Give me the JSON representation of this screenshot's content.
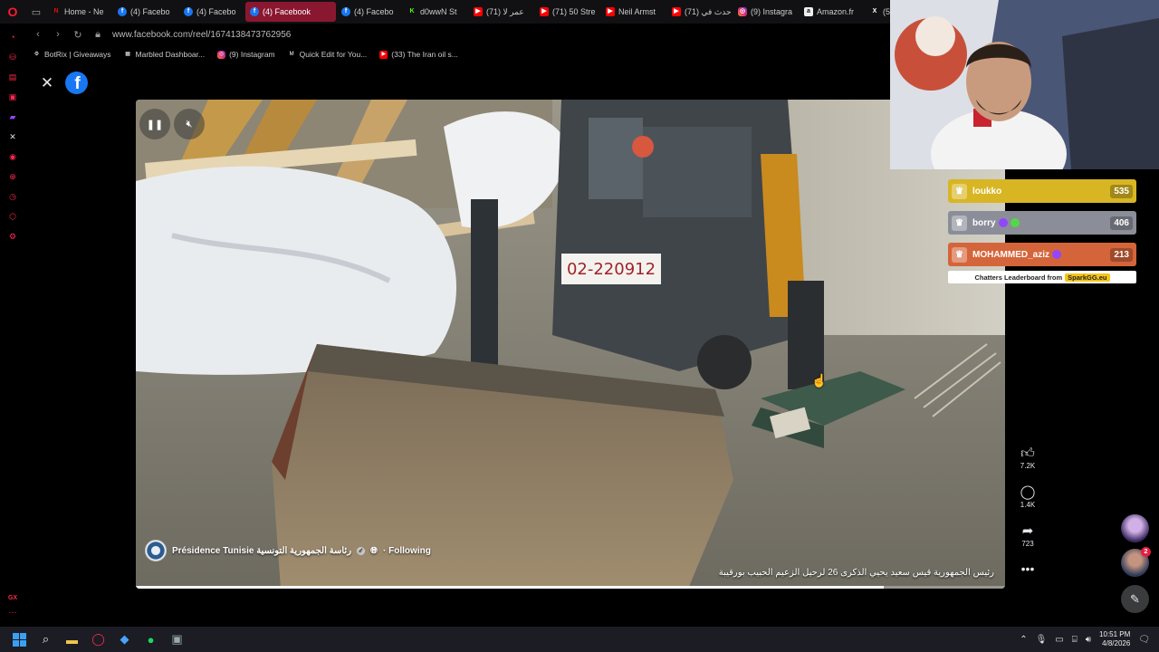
{
  "browser": {
    "tabs": [
      {
        "title": "Home - Ne",
        "favicon": "netflix-icon",
        "fav_text": "N",
        "kind": "nf"
      },
      {
        "title": "(4) Facebo",
        "favicon": "facebook-icon",
        "fav_text": "f",
        "kind": "fb"
      },
      {
        "title": "(4) Facebo",
        "favicon": "facebook-icon",
        "fav_text": "f",
        "kind": "fb"
      },
      {
        "title": "(4) Facebook",
        "favicon": "facebook-icon",
        "fav_text": "f",
        "kind": "fb",
        "active": true
      },
      {
        "title": "(4) Facebo",
        "favicon": "facebook-icon",
        "fav_text": "f",
        "kind": "fb"
      },
      {
        "title": "d0wwN St",
        "favicon": "kick-icon",
        "fav_text": "K",
        "kind": "kk"
      },
      {
        "title": "(71) عمر لا",
        "favicon": "youtube-icon",
        "fav_text": "▶",
        "kind": "yt"
      },
      {
        "title": "(71) 50 Stre",
        "favicon": "youtube-icon",
        "fav_text": "▶",
        "kind": "yt"
      },
      {
        "title": "Neil Armst",
        "favicon": "youtube-icon",
        "fav_text": "▶",
        "kind": "yt"
      },
      {
        "title": "(71) حدث في",
        "favicon": "youtube-icon",
        "fav_text": "▶",
        "kind": "yt"
      },
      {
        "title": "(9) Instagra",
        "favicon": "instagram-icon",
        "fav_text": "◎",
        "kind": "ig"
      },
      {
        "title": "Amazon.fr",
        "favicon": "amazon-icon",
        "fav_text": "a",
        "kind": "am"
      },
      {
        "title": "(5)",
        "favicon": "x-icon",
        "fav_text": "X",
        "kind": "xx"
      }
    ],
    "url": "www.facebook.com/reel/1674138473762956",
    "bookmarks": [
      {
        "label": "BotRix | Giveaways",
        "favicon": "gear-icon",
        "fav_text": "⚙",
        "kind": "xx"
      },
      {
        "label": "Marbled Dashboar...",
        "favicon": "grid-icon",
        "fav_text": "▦",
        "kind": "xx"
      },
      {
        "label": "(9) Instagram",
        "favicon": "instagram-icon",
        "fav_text": "◎",
        "kind": "ig"
      },
      {
        "label": "Quick Edit for You...",
        "favicon": "gmail-icon",
        "fav_text": "M",
        "kind": "xx"
      },
      {
        "label": "(33) The Iran oil s...",
        "favicon": "youtube-icon",
        "fav_text": "▶",
        "kind": "yt"
      }
    ]
  },
  "reel": {
    "logo_text": "f",
    "author": "Présidence Tunisie رئاسة الجمهورية التونسية",
    "following": "· Following",
    "caption": "رئيس الجمهورية قيس سعيد يحيي الذكرى 26 لرحيل الزعيم الحبيب بورقيبة",
    "plate": "02-220912",
    "progress": 0.86,
    "likes": "7.2K",
    "comments": "1.4K",
    "shares": "723"
  },
  "leaderboard": {
    "entries": [
      {
        "name": "loukko",
        "score": "535"
      },
      {
        "name": "borry",
        "score": "406"
      },
      {
        "name": "MOHAMMED_aziz",
        "score": "213"
      }
    ],
    "footer": "Chatters Leaderboard from",
    "brand": "SparkGG.eu"
  },
  "messenger": {
    "badge": "2"
  },
  "taskbar": {
    "time": "10:51 PM",
    "date": "4/8/2026"
  }
}
